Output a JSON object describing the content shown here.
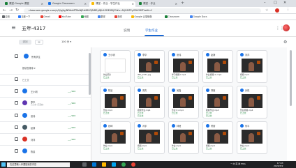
{
  "browser": {
    "tabs": [
      {
        "label": "课堂-Google 课堂",
        "fav": "#188038"
      },
      {
        "label": "Google Classroom",
        "fav": "#1a73e8"
      },
      {
        "label": "课堂 - 作业 - 学生作业",
        "fav": "#fbbc04"
      },
      {
        "label": "课堂 - 作业",
        "fav": "#188038"
      }
    ],
    "new_tab_label": "+",
    "address": "classroom.google.com/u/0/g/tg/NDAxMTMzNjEzNDU3/NDEyMjk1ODE0MjY2#u=MjI1NTEyODU2MTha&t=f",
    "bookmarks": [
      {
        "label": "应用",
        "color": "#5f6368"
      },
      {
        "label": "百度一下",
        "color": "#2979ff"
      },
      {
        "label": "Gmail",
        "color": "#ea4335"
      },
      {
        "label": "YouTube",
        "color": "#ff0000"
      },
      {
        "label": "地图",
        "color": "#34a853"
      },
      {
        "label": "翻译",
        "color": "#4285f4"
      },
      {
        "label": "新闻",
        "color": "#ea4335"
      },
      {
        "label": "Google 云端硬盘",
        "color": "#fbbc04"
      },
      {
        "label": "Classroom",
        "color": "#188038"
      },
      {
        "label": "Google Docs",
        "color": "#4285f4"
      }
    ]
  },
  "app": {
    "class_name": "五年-4317",
    "nav_tabs": [
      "说明",
      "学生作业"
    ],
    "active_tab": 1,
    "toolbar": {
      "return_label": "退回",
      "mail_icon": "✉",
      "points": "100 分"
    }
  },
  "left_panel": {
    "all_students_label": "所有学生",
    "sort_label": "按状态排序",
    "section_label": "已上交",
    "students": [
      {
        "name": "王小明",
        "grade": "___/100",
        "color": "#1a73e8"
      },
      {
        "name": "李华",
        "sub": "已上交 (已迟交)",
        "grade": "___/100",
        "color": "#5e35b1"
      },
      {
        "name": "张伟",
        "grade": "___/100",
        "color": "#1a73e8"
      },
      {
        "name": "赵静",
        "grade": "___/100",
        "color": "#455a64"
      },
      {
        "name": "刘洋",
        "grade": "___/100",
        "color": "#d93025"
      },
      {
        "name": "陈晨",
        "grade": "",
        "color": "#1a73e8"
      }
    ]
  },
  "cards": [
    {
      "name": "王小明",
      "file": "作业照片",
      "status": "已上交",
      "status2": "",
      "white": true
    },
    {
      "name": "李华",
      "file": "IMG_2031.jpg",
      "status": "已上交",
      "status2": "",
      "white": false
    },
    {
      "name": "张伟",
      "file": "学习视频1.mp4",
      "status": "已上交",
      "status2": "",
      "white": false
    },
    {
      "name": "赵静",
      "file": "作业视频(1).mp4",
      "status": "已上交",
      "status2": "",
      "white": false
    },
    {
      "name": "刘洋",
      "file": "视频.mp4",
      "status": "已上交",
      "status2": "",
      "white": false
    },
    {
      "name": "陈晨",
      "file": "作业.mp4",
      "status": "已上交",
      "status2": "",
      "white": false
    },
    {
      "name": "周杰",
      "file": "视频作业.mp4",
      "status": "已上交",
      "status2": "已上交",
      "white": false
    },
    {
      "name": "吴磊",
      "file": "作业(1).mp4",
      "status": "已上交",
      "status2": "",
      "white": false
    },
    {
      "name": "郑爽",
      "file": "视频作业.mp4",
      "status": "已上交",
      "status2": "已上交",
      "white": false
    },
    {
      "name": "孙悦",
      "file": "作业视频.mp4",
      "status": "已上交",
      "status2": "",
      "white": false
    },
    {
      "name": "钱坤",
      "file": "作业.mp4",
      "status": "已上交",
      "status2": "",
      "white": false
    },
    {
      "name": "冯宇",
      "file": "视频.mp4",
      "status": "已上交",
      "status2": "",
      "white": false
    },
    {
      "name": "林峰",
      "file": "作业.mp4",
      "status": "已上交",
      "status2": "",
      "white": false
    },
    {
      "name": "黄蕾",
      "file": "视频.mp4",
      "status": "已上交",
      "status2": "",
      "white": false
    },
    {
      "name": "何平",
      "file": "作业.mp4",
      "status": "已上交",
      "status2": "",
      "white": false
    }
  ],
  "taskbar": {
    "search_placeholder": "在这里输入你要搜索的内容",
    "tray_text": "^ 中 英 拼 ENG",
    "time": "17:03",
    "date": "2020/3/2"
  }
}
